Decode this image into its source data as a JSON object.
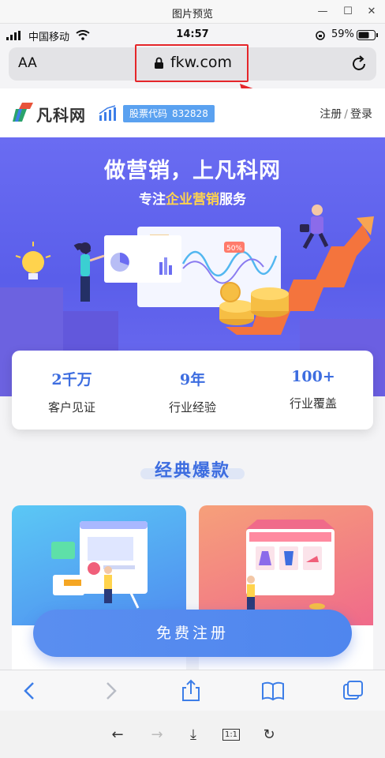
{
  "window": {
    "title": "图片预览"
  },
  "status_bar": {
    "carrier": "中国移动",
    "time": "14:57",
    "battery": "59%"
  },
  "url_bar": {
    "text_size_label": "AA",
    "url": "fkw.com"
  },
  "site_header": {
    "logo_text": "凡科网",
    "stock_label": "股票代码",
    "stock_code": "832828",
    "register_label": "注册",
    "login_label": "登录",
    "separator": "/"
  },
  "hero": {
    "title": "做营销，上凡科网",
    "subtitle_pre": "专注",
    "subtitle_highlight": "企业营销",
    "subtitle_post": "服务",
    "badge": "50%"
  },
  "stats": [
    {
      "value": "2千万",
      "label": "客户见证"
    },
    {
      "value": "9年",
      "label": "行业经验"
    },
    {
      "value": "100+",
      "label": "行业覆盖"
    }
  ],
  "section": {
    "title": "经典爆款"
  },
  "cta": {
    "label": "免费注册"
  },
  "colors": {
    "accent": "#3d6de0",
    "annotation": "#e5262a",
    "hero_bg": "#6a6cf2"
  }
}
